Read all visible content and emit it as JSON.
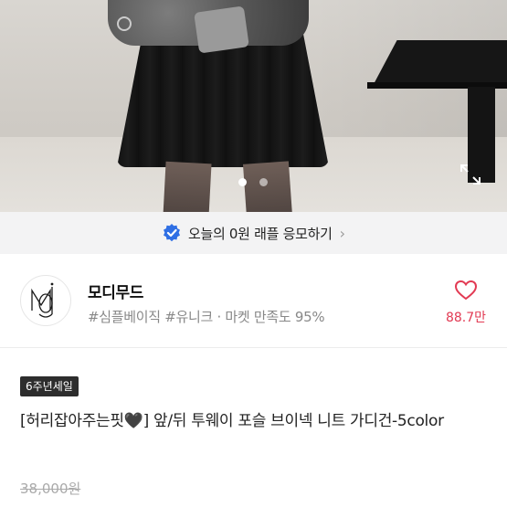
{
  "hero": {
    "image_alt": "product photo",
    "slide_count": 2,
    "active_slide": 1
  },
  "raffle": {
    "text": "오늘의 0원 래플 응모하기",
    "chevron": "›",
    "badge_icon": "verified-badge-icon",
    "badge_color": "#2f6fe4"
  },
  "store": {
    "name": "모디무드",
    "tags": "#심플베이직 #유니크",
    "separator": "·",
    "satisfaction": "마켓 만족도 95%",
    "like_count": "88.7만",
    "like_color": "#e23a53"
  },
  "product": {
    "badge": "6주년세일",
    "title": "[허리잡아주는핏🖤]  앞/뒤 투웨이 포슬 브이넥 니트 가디건-5color",
    "original_price": "38,000원"
  }
}
